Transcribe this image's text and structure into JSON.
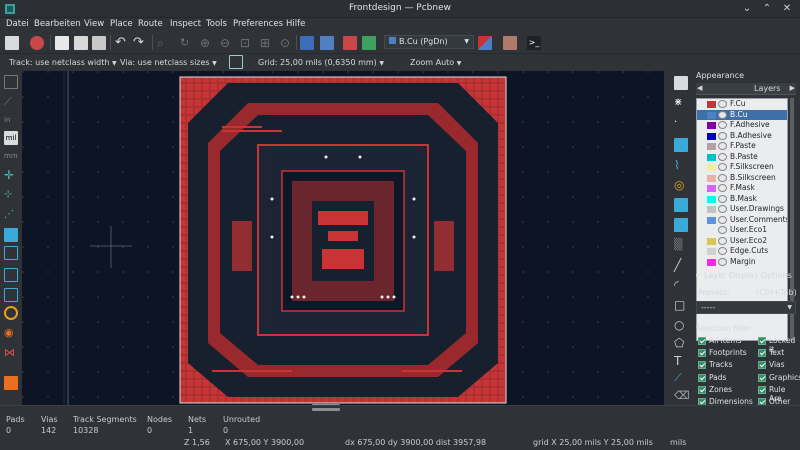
{
  "window": {
    "title": "Frontdesign — Pcbnew"
  },
  "menu": [
    "Datei",
    "Bearbeiten",
    "View",
    "Place",
    "Route",
    "Inspect",
    "Tools",
    "Preferences",
    "Hilfe"
  ],
  "toolbar": {
    "layer_select": "B.Cu (PgDn)",
    "track_width": "Track: use netclass width",
    "via_size": "Via: use netclass sizes",
    "grid": "Grid: 25,00 mils (0,6350 mm)",
    "zoom": "Zoom Auto"
  },
  "appearance": {
    "title": "Appearance",
    "tab_layers": "Layers",
    "layers": [
      {
        "name": "F.Cu",
        "color": "#c83434"
      },
      {
        "name": "B.Cu",
        "color": "#4d7fc4"
      },
      {
        "name": "F.Adhesive",
        "color": "#84009c"
      },
      {
        "name": "B.Adhesive",
        "color": "#0000b8"
      },
      {
        "name": "F.Paste",
        "color": "#b4a0a0"
      },
      {
        "name": "B.Paste",
        "color": "#00c2c2"
      },
      {
        "name": "F.Silkscreen",
        "color": "#f2eda1"
      },
      {
        "name": "B.Silkscreen",
        "color": "#e8b2a7"
      },
      {
        "name": "F.Mask",
        "color": "#d864ff"
      },
      {
        "name": "B.Mask",
        "color": "#02ffee"
      },
      {
        "name": "User.Drawings",
        "color": "#c2c2c2"
      },
      {
        "name": "User.Comments",
        "color": "#5994dc"
      },
      {
        "name": "User.Eco1",
        "color": "#b4db d2"
      },
      {
        "name": "User.Eco2",
        "color": "#d8c852"
      },
      {
        "name": "Edge.Cuts",
        "color": "#d0d2cd"
      },
      {
        "name": "Margin",
        "color": "#ff26e2"
      }
    ],
    "layer_display_options": "Layer Display Options",
    "presets_label": "Presets:",
    "presets_shortcut": "(Ctrl+Tab)",
    "presets_value": "-----",
    "selection_filter_title": "Selection filter",
    "selection_filter": [
      [
        "All items",
        "Locked it"
      ],
      [
        "Footprints",
        "Text"
      ],
      [
        "Tracks",
        "Vias"
      ],
      [
        "Pads",
        "Graphics"
      ],
      [
        "Zones",
        "Rule Are"
      ],
      [
        "Dimensions",
        "Other ite"
      ]
    ]
  },
  "messages": {
    "headers": [
      "Pads",
      "Vias",
      "Track Segments",
      "Nodes",
      "Nets",
      "Unrouted"
    ],
    "values": [
      "0",
      "142",
      "10328",
      "0",
      "1",
      "0"
    ]
  },
  "status": {
    "zoom": "Z 1,56",
    "xy": "X 675,00  Y 3900,00",
    "delta": "dx 675,00  dy 3900,00  dist 3957,98",
    "grid": "grid X 25,00 mils  Y 25,00 mils",
    "units": "mils"
  }
}
